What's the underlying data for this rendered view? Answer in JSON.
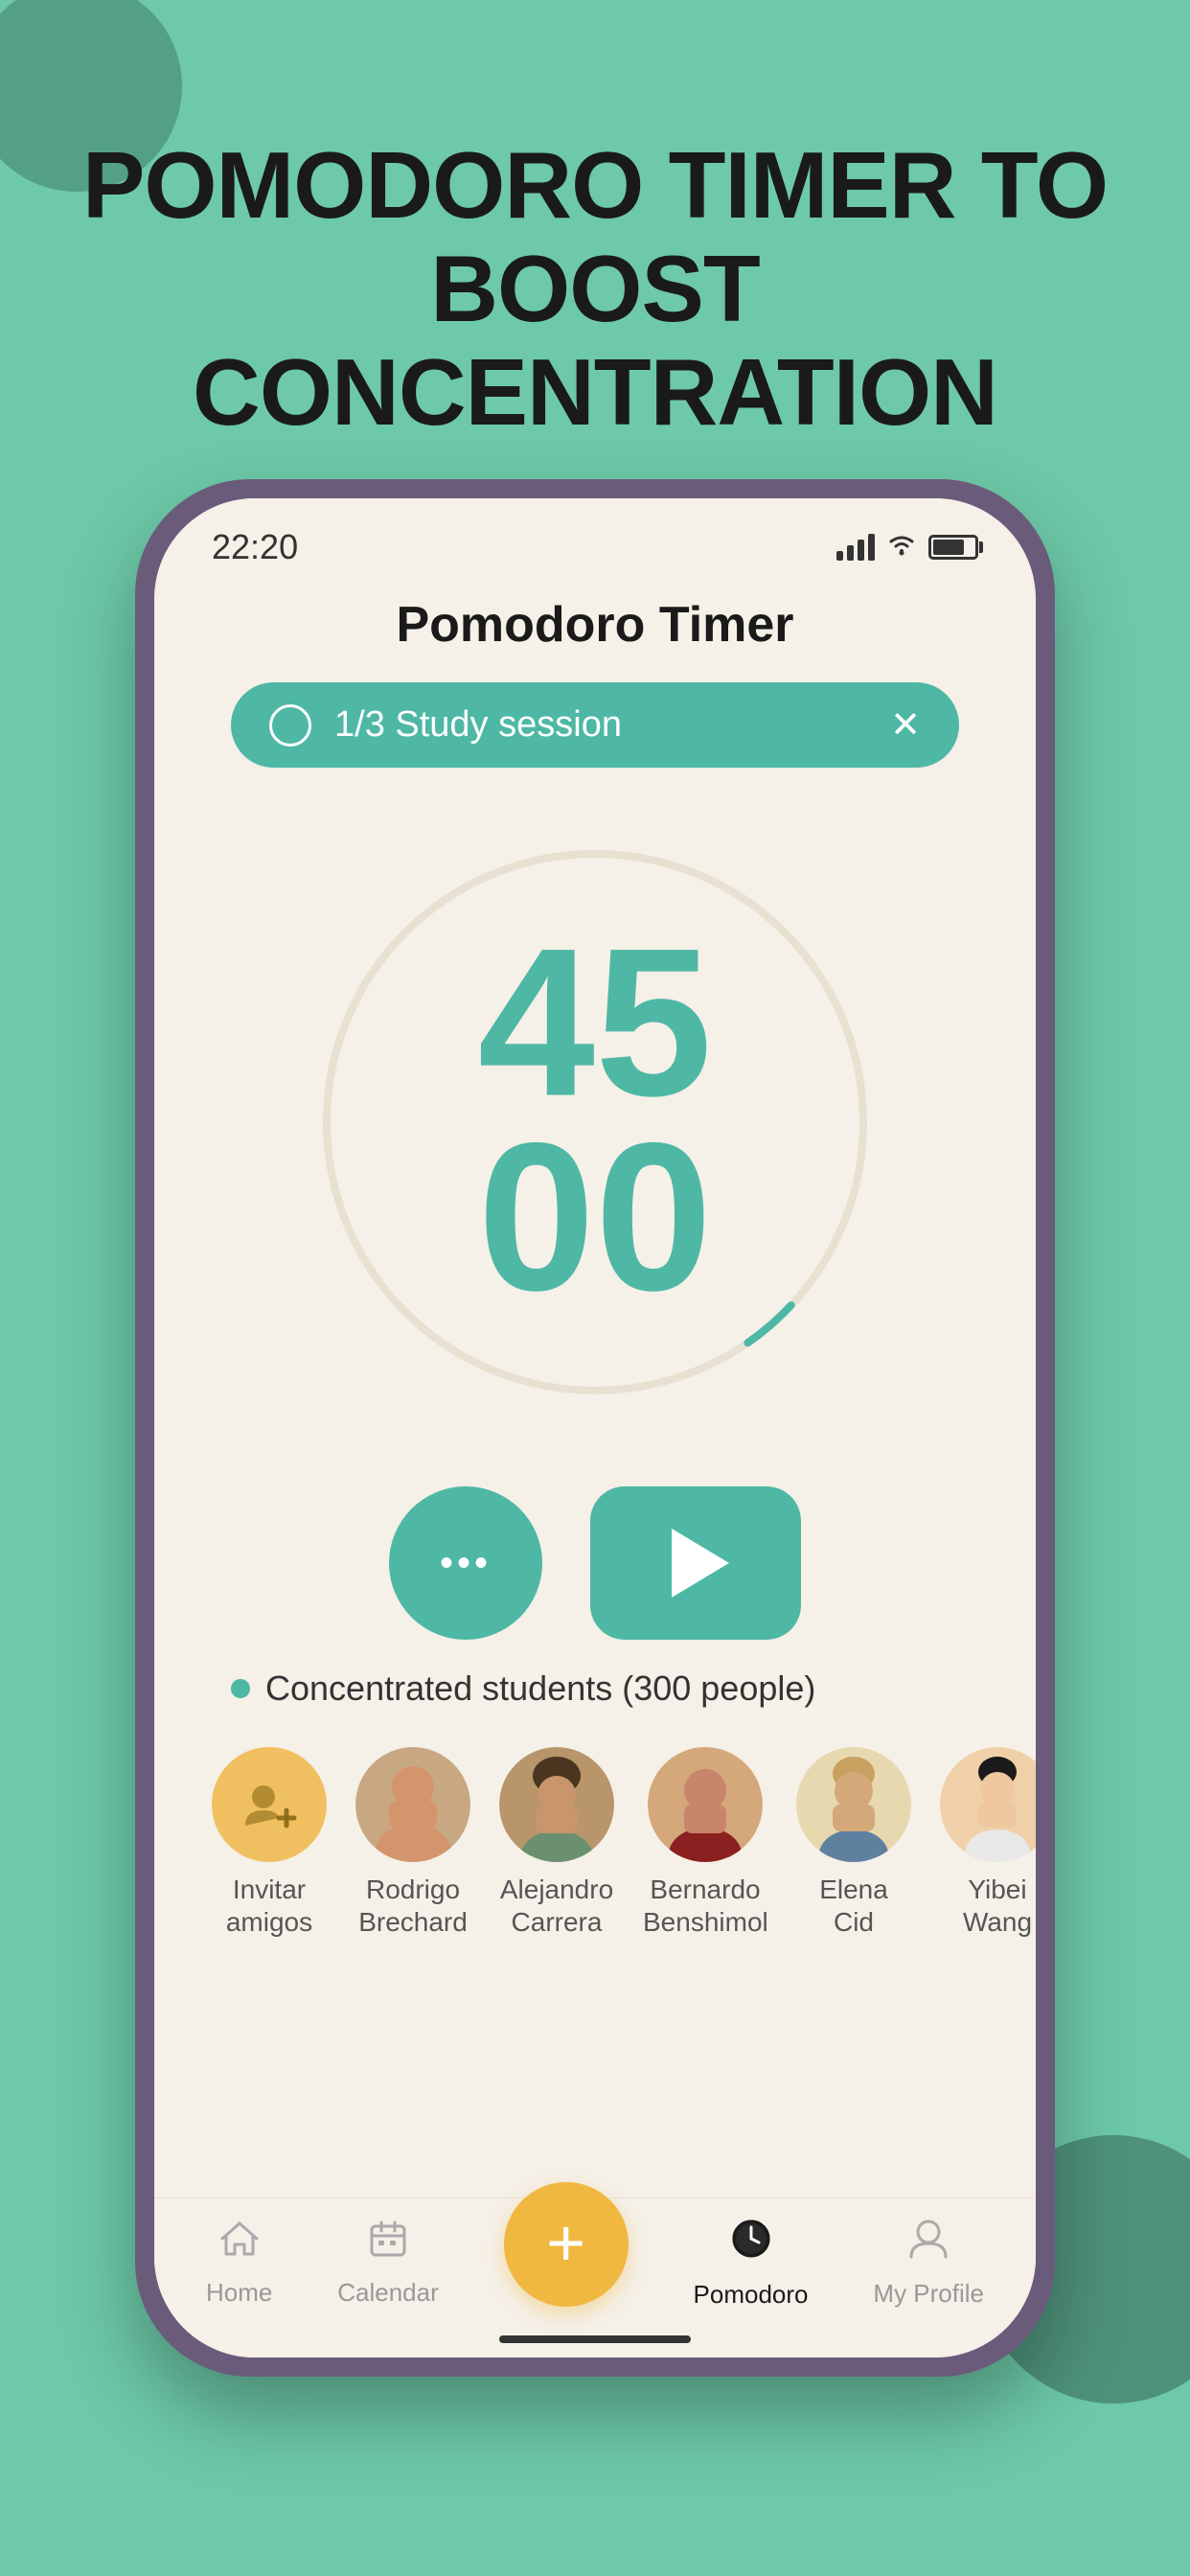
{
  "app": {
    "background_color": "#6dc9a8",
    "hero_text": "POMODORO TIMER TO BOOST CONCENTRATION",
    "decorative_circle_top_color": "#4a8f77",
    "decorative_circle_bottom_color": "#3a6e5e"
  },
  "status_bar": {
    "time": "22:20",
    "signal_bars": 4,
    "wifi": true,
    "battery_percent": 75
  },
  "screen": {
    "title": "Pomodoro Timer",
    "session_pill": {
      "label": "1/3 Study session"
    },
    "timer": {
      "minutes": "45",
      "seconds": "00"
    },
    "buttons": {
      "more_label": "...",
      "play_label": "▶"
    },
    "students": {
      "label": "Concentrated students (300 people)",
      "list": [
        {
          "name": "Invitar\namigos",
          "type": "invite"
        },
        {
          "name": "Rodrigo\nBrechard",
          "type": "person"
        },
        {
          "name": "Alejandro\nCarrera",
          "type": "person"
        },
        {
          "name": "Bernardo\nBenshimol",
          "type": "person"
        },
        {
          "name": "Elena\nCid",
          "type": "person"
        },
        {
          "name": "Yibei\nWang",
          "type": "person"
        }
      ]
    }
  },
  "bottom_nav": {
    "items": [
      {
        "label": "Home",
        "icon": "home",
        "active": false
      },
      {
        "label": "Calendar",
        "icon": "calendar",
        "active": false
      },
      {
        "label": "+",
        "icon": "plus",
        "active": false,
        "special": true
      },
      {
        "label": "Pomodoro",
        "icon": "clock",
        "active": true
      },
      {
        "label": "My Profile",
        "icon": "person",
        "active": false
      }
    ]
  }
}
